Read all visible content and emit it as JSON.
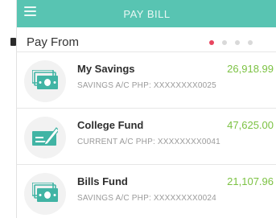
{
  "header": {
    "title": "PAY BILL",
    "background": "#58c4b2"
  },
  "section": {
    "title": "Pay From"
  },
  "pager": {
    "active_index": 0,
    "count": 4,
    "active_color": "#e8465f",
    "inactive_color": "#d9d9d9"
  },
  "accounts": [
    {
      "name": "My Savings",
      "amount": "26,918.99",
      "number": "SAVINGS A/C PHP: XXXXXXXX0025",
      "icon": "cash-icon"
    },
    {
      "name": "College Fund",
      "amount": "47,625.00",
      "number": "CURRENT A/C PHP: XXXXXXXX0041",
      "icon": "cheque-icon"
    },
    {
      "name": "Bills Fund",
      "amount": "21,107.96",
      "number": "SAVINGS A/C PHP: XXXXXXXX0024",
      "icon": "cash-icon"
    }
  ],
  "colors": {
    "amount": "#7cc243",
    "icon": "#41b4a4"
  }
}
